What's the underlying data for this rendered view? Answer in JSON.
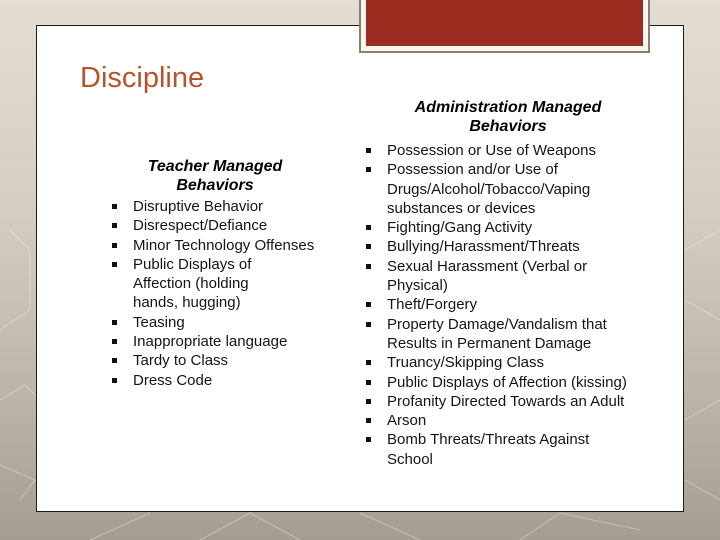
{
  "slide": {
    "title": "Discipline",
    "colors": {
      "title": "#b5532c",
      "accent_box": "#9b2d20",
      "card_background": "#ffffff"
    },
    "teacher_column": {
      "heading_line1": "Teacher Managed",
      "heading_line2": "Behaviors",
      "items": [
        "Disruptive Behavior",
        "Disrespect/Defiance",
        "Minor Technology Offenses",
        "Public Displays of Affection (holding hands, hugging)",
        "Teasing",
        "Inappropriate language",
        "Tardy to Class",
        "Dress Code"
      ]
    },
    "administration_column": {
      "heading_line1": "Administration Managed",
      "heading_line2": "Behaviors",
      "items": [
        "Possession or Use of Weapons",
        "Possession and/or Use of Drugs/Alcohol/Tobacco/Vaping substances or devices",
        "Fighting/Gang Activity",
        "Bullying/Harassment/Threats",
        "Sexual Harassment (Verbal or Physical)",
        "Theft/Forgery",
        "Property Damage/Vandalism that Results in Permanent Damage",
        "Truancy/Skipping Class",
        "Public Displays of Affection (kissing)",
        "Profanity Directed Towards an Adult",
        "Arson",
        "Bomb Threats/Threats Against School"
      ]
    }
  }
}
